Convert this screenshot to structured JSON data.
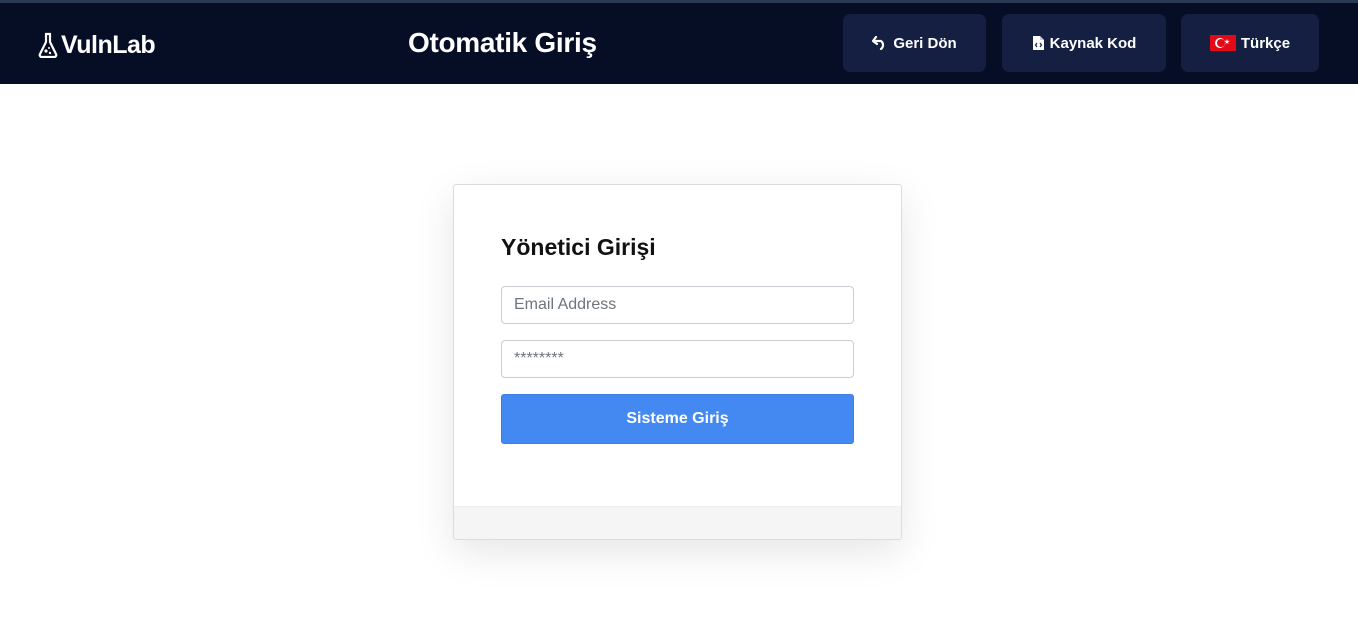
{
  "header": {
    "brand": "VulnLab",
    "title": "Otomatik Giriş",
    "buttons": {
      "back_label": "Geri Dön",
      "source_label": "Kaynak Kod",
      "language_label": "Türkçe"
    }
  },
  "login": {
    "heading": "Yönetici Girişi",
    "email_placeholder": "Email Address",
    "password_placeholder": "********",
    "submit_label": "Sisteme Giriş"
  },
  "colors": {
    "header_bg": "#060e26",
    "nav_button_bg": "#141f42",
    "submit_bg": "#4489f2"
  },
  "icons": {
    "brand": "flask-icon",
    "back": "undo-arrow-icon",
    "source": "code-file-icon",
    "language": "turkey-flag-icon"
  }
}
